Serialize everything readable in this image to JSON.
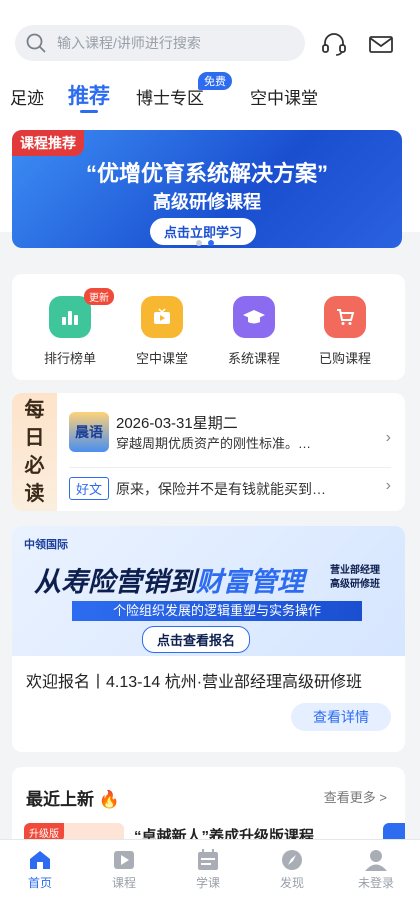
{
  "search": {
    "placeholder": "输入课程/讲师进行搜索"
  },
  "tabs": [
    {
      "label": "足迹"
    },
    {
      "label": "推荐"
    },
    {
      "label": "博士专区"
    },
    {
      "label": "空中课堂"
    }
  ],
  "free_badge": "免费",
  "banner": {
    "tag": "课程推荐",
    "title": "“优增优育系统解决方案”",
    "subtitle": "高级研修课程",
    "cta": "点击立即学习"
  },
  "quick": {
    "new_badge": "更新",
    "items": [
      {
        "label": "排行榜单",
        "icon": "bar-chart-icon",
        "color": "#3ec59a"
      },
      {
        "label": "空中课堂",
        "icon": "tv-icon",
        "color": "#f7b731"
      },
      {
        "label": "系统课程",
        "icon": "graduation-cap-icon",
        "color": "#8b6cf0"
      },
      {
        "label": "已购课程",
        "icon": "cart-icon",
        "color": "#f26a5b"
      }
    ]
  },
  "daily": {
    "side": [
      "每",
      "日",
      "必",
      "读"
    ],
    "logo": "晨语",
    "date": "2026-03-31星期二",
    "summary": "穿越周期优质资产的刚性标准。…",
    "good_badge": "好文",
    "good_text": "原来，保险并不是有钱就能买到…"
  },
  "promo": {
    "brand": "中领国际",
    "title_part1": "从寿险营销到",
    "title_part2": "财富管理",
    "side_line1": "营业部经理",
    "side_line2": "高级研修班",
    "strip": "个险组织发展的逻辑重塑与实务操作",
    "cta": "点击查看报名",
    "text": "欢迎报名丨4.13-14 杭州·营业部经理高级研修班",
    "button": "查看详情"
  },
  "latest": {
    "title": "最近上新",
    "more": "查看更多 >",
    "upgrade_badge": "升级版",
    "course": "“卓越新人”养成升级版课程"
  },
  "nav": [
    {
      "label": "首页",
      "icon": "home-icon",
      "active": true
    },
    {
      "label": "课程",
      "icon": "play-icon"
    },
    {
      "label": "学课",
      "icon": "calendar-icon"
    },
    {
      "label": "发现",
      "icon": "compass-icon"
    },
    {
      "label": "未登录",
      "icon": "user-icon"
    }
  ],
  "colors": {
    "accent": "#2d6cf0",
    "badge_red": "#f04b3a"
  }
}
